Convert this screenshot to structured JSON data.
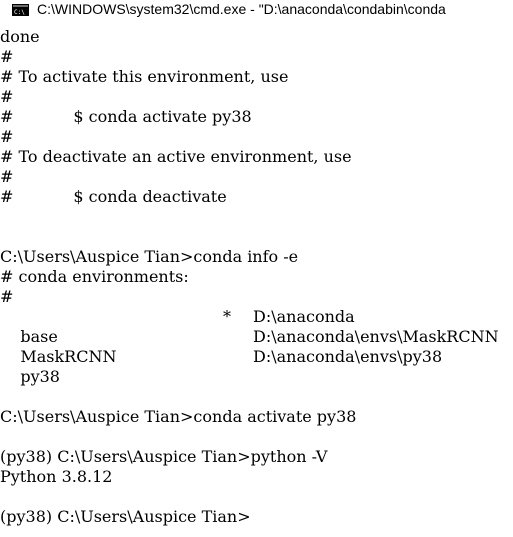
{
  "window": {
    "title": "C:\\WINDOWS\\system32\\cmd.exe - \"D:\\anaconda\\condabin\\conda"
  },
  "icons": {
    "app": "cmd-console-icon"
  },
  "colors": {
    "background": "#ffffff",
    "text": "#000000"
  },
  "console": {
    "l0": "done",
    "l1": "#",
    "l2": "# To activate this environment, use",
    "l3": "#",
    "l4_hash": "#",
    "l4_cmd": "$ conda activate py38",
    "l5": "#",
    "l6": "# To deactivate an active environment, use",
    "l7": "#",
    "l8_hash": "#",
    "l8_cmd": "$ conda deactivate",
    "l11": "C:\\Users\\Auspice Tian>conda info -e",
    "l12": "# conda environments:",
    "l13": "#",
    "envs": [
      {
        "name": "base",
        "star": "*",
        "path": "D:\\anaconda"
      },
      {
        "name": "MaskRCNN",
        "star": "",
        "path": "D:\\anaconda\\envs\\MaskRCNN"
      },
      {
        "name": "py38",
        "star": "",
        "path": "D:\\anaconda\\envs\\py38"
      }
    ],
    "l19": "C:\\Users\\Auspice Tian>conda activate py38",
    "l21": "(py38) C:\\Users\\Auspice Tian>python -V",
    "l22": "Python 3.8.12",
    "l24": "(py38) C:\\Users\\Auspice Tian>"
  }
}
